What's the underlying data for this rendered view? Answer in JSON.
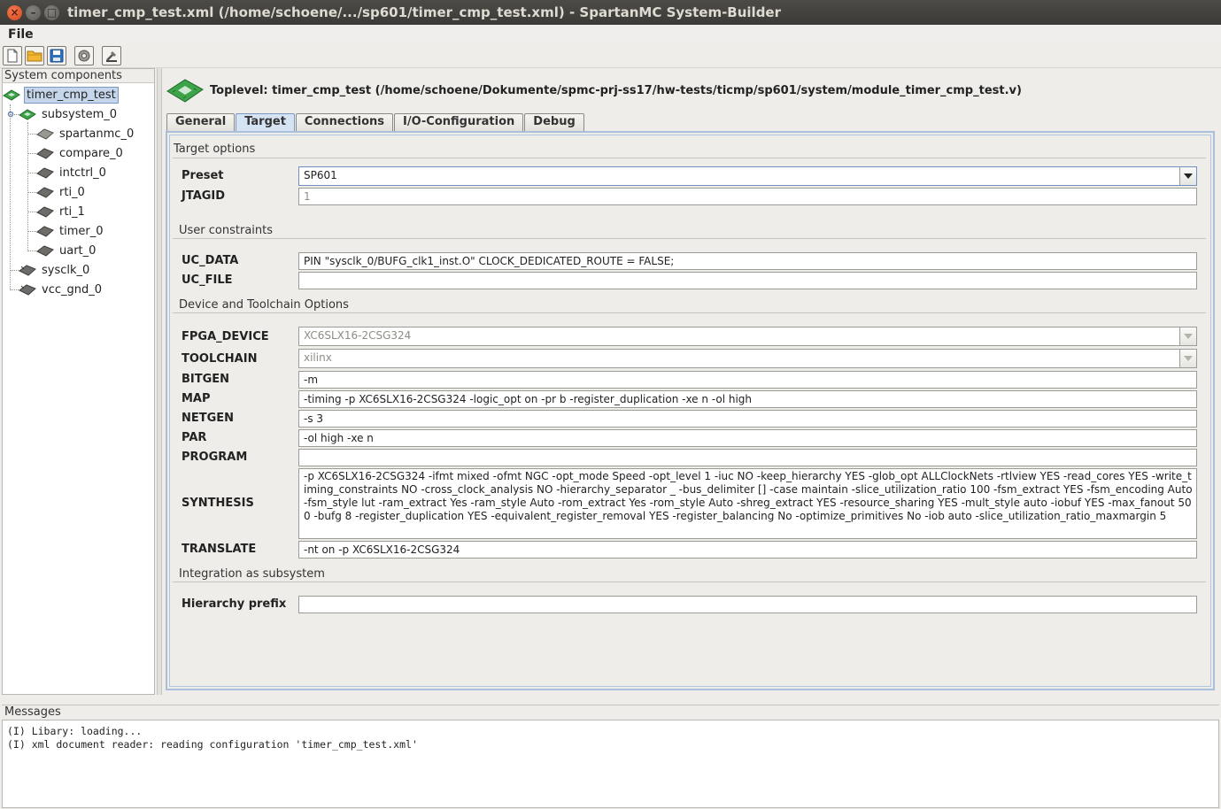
{
  "window": {
    "title": "timer_cmp_test.xml (/home/schoene/.../sp601/timer_cmp_test.xml) - SpartanMC System-Builder",
    "close_glyph": "×",
    "min_glyph": "–",
    "max_glyph": "□"
  },
  "menu": {
    "file": "File"
  },
  "toolbar": {
    "buttons": [
      "new-file-icon",
      "open-folder-icon",
      "save-icon",
      "settings-gear-icon",
      "build-icon"
    ]
  },
  "tree": {
    "header": "System components",
    "root": "timer_cmp_test",
    "subsystem": "subsystem_0",
    "children": [
      "spartanmc_0",
      "compare_0",
      "intctrl_0",
      "rti_0",
      "rti_1",
      "timer_0",
      "uart_0"
    ],
    "siblings": [
      "sysclk_0",
      "vcc_gnd_0"
    ]
  },
  "header": {
    "toplevel": "Toplevel: timer_cmp_test (/home/schoene/Dokumente/spmc-prj-ss17/hw-tests/ticmp/sp601/system/module_timer_cmp_test.v)"
  },
  "tabs": [
    "General",
    "Target",
    "Connections",
    "I/O-Configuration",
    "Debug"
  ],
  "target": {
    "sec_target": "Target options",
    "preset_label": "Preset",
    "preset_value": "SP601",
    "jtagid_label": "JTAGID",
    "jtagid_value": "1",
    "sec_user": "User constraints",
    "uc_data_label": "UC_DATA",
    "uc_data_value": "PIN \"sysclk_0/BUFG_clk1_inst.O\" CLOCK_DEDICATED_ROUTE = FALSE;",
    "uc_file_label": "UC_FILE",
    "uc_file_value": "",
    "sec_device": "Device and Toolchain Options",
    "fpga_label": "FPGA_DEVICE",
    "fpga_value": "XC6SLX16-2CSG324",
    "toolchain_label": "TOOLCHAIN",
    "toolchain_value": "xilinx",
    "bitgen_label": "BITGEN",
    "bitgen_value": "-m",
    "map_label": "MAP",
    "map_value": "-timing -p XC6SLX16-2CSG324 -logic_opt on -pr b -register_duplication -xe n -ol high",
    "netgen_label": "NETGEN",
    "netgen_value": "-s 3",
    "par_label": "PAR",
    "par_value": "-ol high -xe n",
    "program_label": "PROGRAM",
    "program_value": "",
    "synthesis_label": "SYNTHESIS",
    "synthesis_value": "-p XC6SLX16-2CSG324 -ifmt mixed -ofmt NGC -opt_mode Speed -opt_level 1 -iuc NO -keep_hierarchy YES -glob_opt ALLClockNets -rtlview YES -read_cores YES -write_timing_constraints NO -cross_clock_analysis NO -hierarchy_separator _ -bus_delimiter [] -case maintain -slice_utilization_ratio 100 -fsm_extract YES -fsm_encoding Auto -fsm_style lut -ram_extract Yes -ram_style Auto -rom_extract Yes -rom_style Auto -shreg_extract YES -resource_sharing YES -mult_style auto -iobuf YES -max_fanout 500 -bufg 8 -register_duplication YES -equivalent_register_removal YES -register_balancing No -optimize_primitives No -iob auto -slice_utilization_ratio_maxmargin 5",
    "translate_label": "TRANSLATE",
    "translate_value": "-nt on -p XC6SLX16-2CSG324",
    "sec_integration": "Integration as subsystem",
    "hier_label": "Hierarchy prefix",
    "hier_value": ""
  },
  "messages": {
    "header": "Messages",
    "lines": [
      "(I) Libary: loading...",
      "(I) xml document reader: reading configuration 'timer_cmp_test.xml'"
    ]
  }
}
